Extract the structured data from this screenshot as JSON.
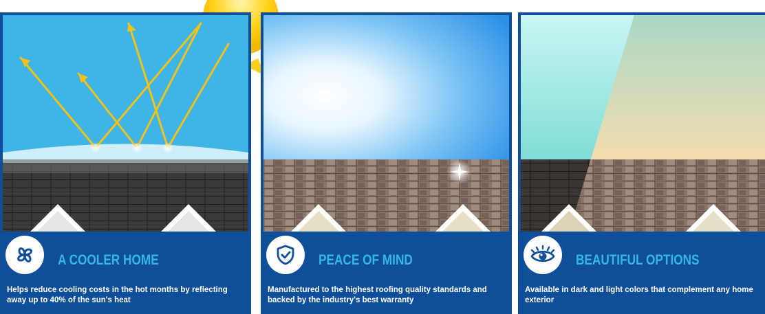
{
  "cards": [
    {
      "title": "A COOLER HOME",
      "description": "Helps reduce cooling costs in the hot months by reflecting away up to 40% of the sun's heat",
      "icon": "fan-icon"
    },
    {
      "title": "PEACE OF MIND",
      "description": "Manufactured to the highest roofing quality standards and backed by the industry's best warranty",
      "icon": "shield-check-icon"
    },
    {
      "title": "BEAUTIFUL OPTIONS",
      "description": "Available in dark and light colors that complement any home exterior",
      "icon": "eye-icon"
    }
  ],
  "colors": {
    "card_bg": "#0f4e98",
    "title": "#34b7e5",
    "sky_cool": "#3fb4e6",
    "sun": "#ffcc1a",
    "ray": "#f2c21a"
  }
}
